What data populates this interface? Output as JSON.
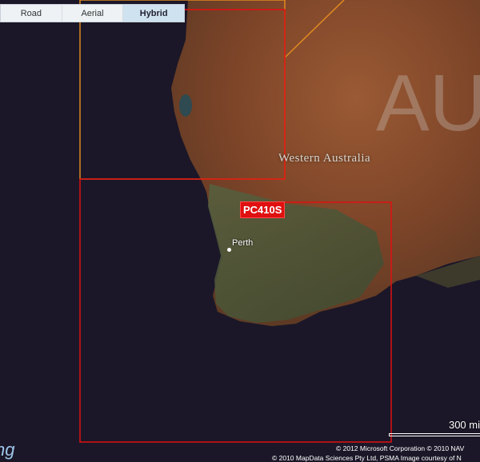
{
  "map_type_tabs": [
    {
      "label": "Road",
      "active": false
    },
    {
      "label": "Aerial",
      "active": false
    },
    {
      "label": "Hybrid",
      "active": true
    }
  ],
  "labels": {
    "region": "Western Australia",
    "country_partial": "AU",
    "city": "Perth"
  },
  "chart_coverage": {
    "id": "PC410S",
    "color": "#e01010"
  },
  "scale": {
    "label": "300 mi"
  },
  "attribution": {
    "line1": "© 2012 Microsoft Corporation   © 2010 NAV",
    "line2": "© 2010 MapData Sciences Pty Ltd, PSMA     Image courtesy of N"
  },
  "logo_text": "ng",
  "colors": {
    "ocean": "#1b1728",
    "land_desert": "#8a4e2e",
    "land_green": "#4f5a3a",
    "overlay_red": "#e01010",
    "overlay_orange": "#e08a20"
  }
}
